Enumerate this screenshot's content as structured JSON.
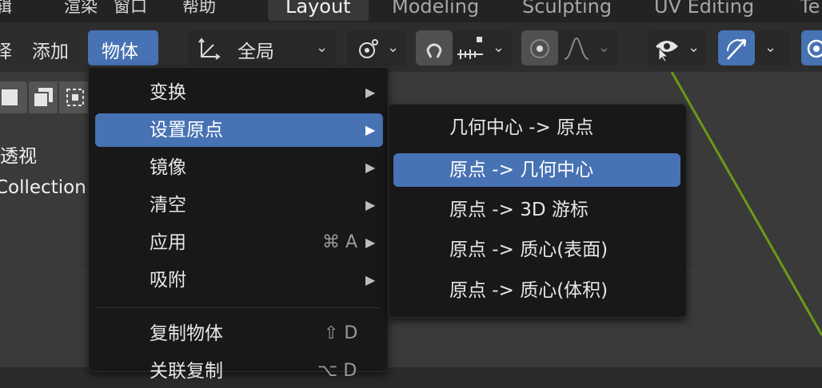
{
  "topbar": {
    "menus": [
      "辑",
      "渲染",
      "窗口",
      "帮助"
    ],
    "workspace_tabs": [
      "Layout",
      "Modeling",
      "Sculpting",
      "UV Editing",
      "Te"
    ]
  },
  "header": {
    "cut_label": "择",
    "add_label": "添加",
    "object_label": "物体",
    "transform_orientation": "全局"
  },
  "viewport": {
    "perspective_label": "透视",
    "collection_label": "Collection"
  },
  "object_menu": {
    "items": [
      {
        "label": "变换",
        "arrow": "▶"
      },
      {
        "label": "设置原点",
        "arrow": "▶"
      },
      {
        "label": "镜像",
        "arrow": "▶"
      },
      {
        "label": "清空",
        "arrow": "▶"
      },
      {
        "label": "应用",
        "shortcut": "⌘ A",
        "arrow": "▶"
      },
      {
        "label": "吸附",
        "arrow": "▶"
      },
      {
        "label": "复制物体",
        "shortcut": "⇧ D"
      },
      {
        "label": "关联复制",
        "shortcut": "⌥ D"
      }
    ]
  },
  "origin_submenu": {
    "items": [
      {
        "label": "几何中心 -> 原点"
      },
      {
        "label": "原点 -> 几何中心"
      },
      {
        "label": "原点 -> 3D 游标"
      },
      {
        "label": "原点 -> 质心(表面)"
      },
      {
        "label": "原点 -> 质心(体积)"
      }
    ]
  },
  "colors": {
    "accent": "#4772b3",
    "menu_bg": "#181818",
    "viewport_bg": "#3a3a3a",
    "axis_green": "#6a9a1a"
  }
}
